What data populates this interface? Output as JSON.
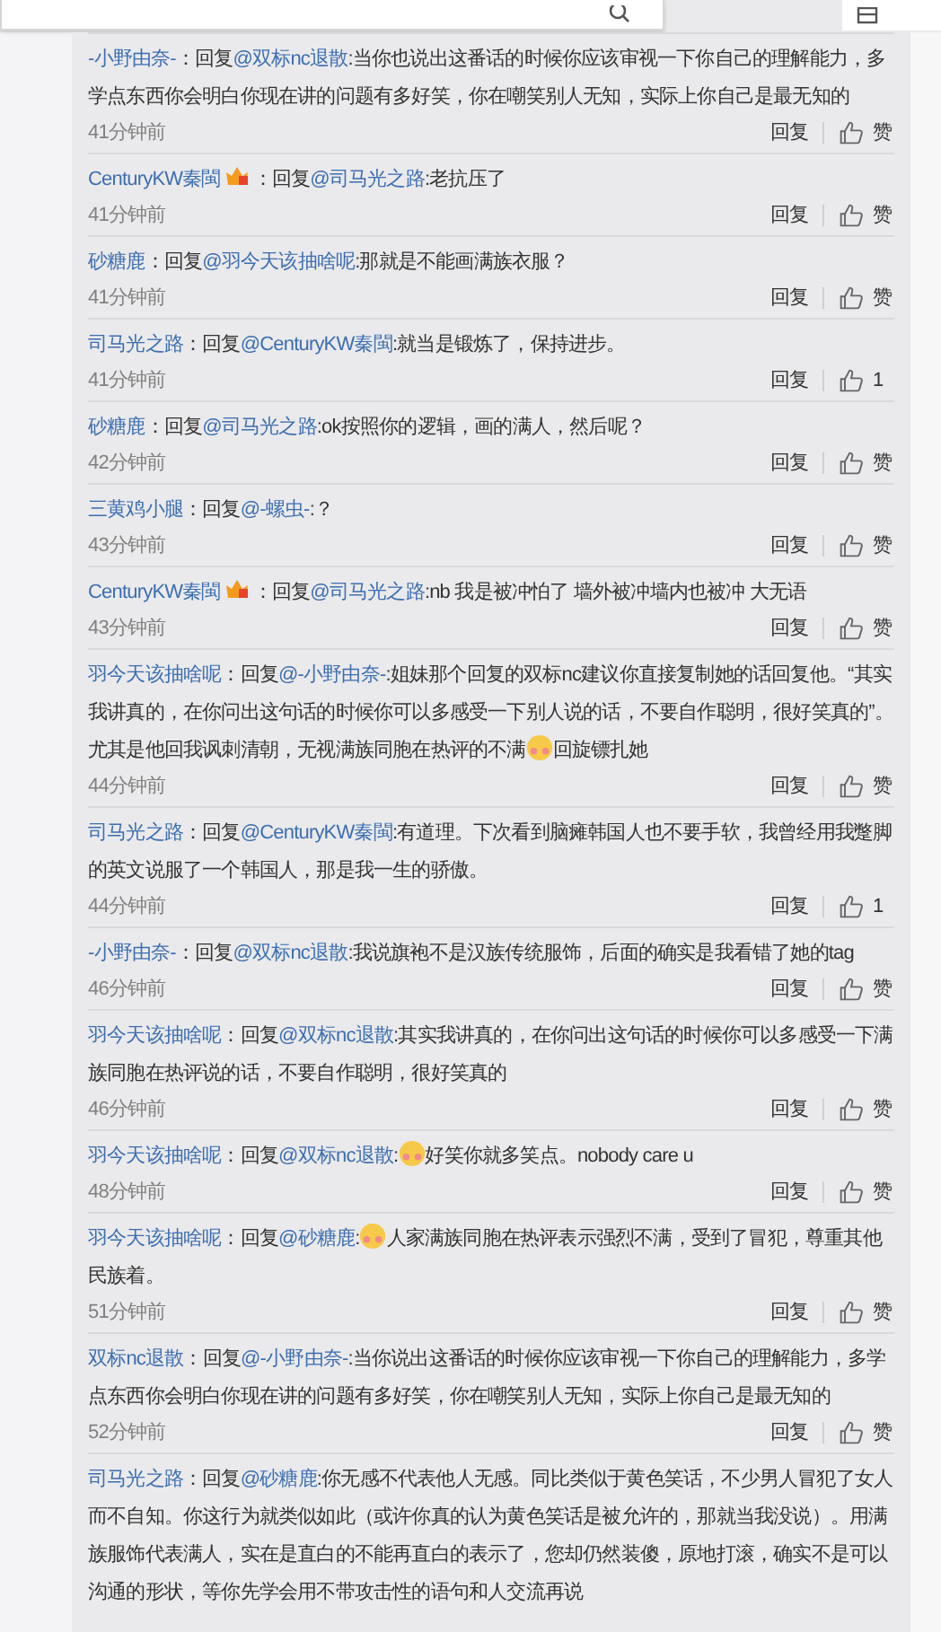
{
  "comments": [
    {
      "user": "-小野由奈-",
      "badge": false,
      "reply": "：回复",
      "target": "@双标nc退散",
      "parts": [
        {
          "kind": "text",
          "text": ":当你也说出这番话的时候你应该审视一下你自己的理解能力，多学点东西你会明白你现在讲的问题有多好笑，你在嘲笑别人无知，实际上你自己是最无知的"
        }
      ],
      "time": "41分钟前",
      "reply_button": "回复",
      "like": "赞"
    },
    {
      "user": "CenturyKW秦閩",
      "badge": true,
      "reply": "：回复",
      "target": "@司马光之路",
      "parts": [
        {
          "kind": "text",
          "text": ":老抗压了"
        }
      ],
      "time": "41分钟前",
      "reply_button": "回复",
      "like": "赞"
    },
    {
      "user": "砂糖鹿",
      "badge": false,
      "reply": "：回复",
      "target": "@羽今天该抽啥呢",
      "parts": [
        {
          "kind": "text",
          "text": ":那就是不能画满族衣服？"
        }
      ],
      "time": "41分钟前",
      "reply_button": "回复",
      "like": "赞"
    },
    {
      "user": "司马光之路",
      "badge": false,
      "reply": "：回复",
      "target": "@CenturyKW秦閩",
      "parts": [
        {
          "kind": "text",
          "text": ":就当是锻炼了，保持进步。"
        }
      ],
      "time": "41分钟前",
      "reply_button": "回复",
      "like": "1"
    },
    {
      "user": "砂糖鹿",
      "badge": false,
      "reply": "：回复",
      "target": "@司马光之路",
      "parts": [
        {
          "kind": "text",
          "text": ":ok按照你的逻辑，画的满人，然后呢？"
        }
      ],
      "time": "42分钟前",
      "reply_button": "回复",
      "like": "赞"
    },
    {
      "user": "三黄鸡小腿",
      "badge": false,
      "reply": "：回复",
      "target": "@-螺虫-",
      "parts": [
        {
          "kind": "text",
          "text": ":？"
        }
      ],
      "time": "43分钟前",
      "reply_button": "回复",
      "like": "赞"
    },
    {
      "user": "CenturyKW秦閩",
      "badge": true,
      "reply": "：回复",
      "target": "@司马光之路",
      "parts": [
        {
          "kind": "text",
          "text": ":nb 我是被冲怕了 墙外被冲墙内也被冲 大无语"
        }
      ],
      "time": "43分钟前",
      "reply_button": "回复",
      "like": "赞"
    },
    {
      "user": "羽今天该抽啥呢",
      "badge": false,
      "reply": "：回复",
      "target": "@-小野由奈-",
      "parts": [
        {
          "kind": "text",
          "text": ":姐妹那个回复的双标nc建议你直接复制她的话回复他。“其实我讲真的，在你问出这句话的时候你可以多感受一下别人说的话，不要自作聪明，很好笑真的”。尤其是他回我讽刺清朝，无视满族同胞在热评的不满"
        },
        {
          "kind": "emoji"
        },
        {
          "kind": "text",
          "text": "回旋镖扎她"
        }
      ],
      "time": "44分钟前",
      "reply_button": "回复",
      "like": "赞"
    },
    {
      "user": "司马光之路",
      "badge": false,
      "reply": "：回复",
      "target": "@CenturyKW秦閩",
      "parts": [
        {
          "kind": "text",
          "text": ":有道理。下次看到脑瘫韩国人也不要手软，我曾经用我蹩脚的英文说服了一个韩国人，那是我一生的骄傲。"
        }
      ],
      "time": "44分钟前",
      "reply_button": "回复",
      "like": "1"
    },
    {
      "user": "-小野由奈-",
      "badge": false,
      "reply": "：回复",
      "target": "@双标nc退散",
      "parts": [
        {
          "kind": "text",
          "text": ":我说旗袍不是汉族传统服饰，后面的确实是我看错了她的tag"
        }
      ],
      "time": "46分钟前",
      "reply_button": "回复",
      "like": "赞"
    },
    {
      "user": "羽今天该抽啥呢",
      "badge": false,
      "reply": "：回复",
      "target": "@双标nc退散",
      "parts": [
        {
          "kind": "text",
          "text": ":其实我讲真的，在你问出这句话的时候你可以多感受一下满族同胞在热评说的话，不要自作聪明，很好笑真的"
        }
      ],
      "time": "46分钟前",
      "reply_button": "回复",
      "like": "赞"
    },
    {
      "user": "羽今天该抽啥呢",
      "badge": false,
      "reply": "：回复",
      "target": "@双标nc退散",
      "parts": [
        {
          "kind": "text",
          "text": ":"
        },
        {
          "kind": "emoji"
        },
        {
          "kind": "text",
          "text": "好笑你就多笑点。nobody care u"
        }
      ],
      "time": "48分钟前",
      "reply_button": "回复",
      "like": "赞"
    },
    {
      "user": "羽今天该抽啥呢",
      "badge": false,
      "reply": "：回复",
      "target": "@砂糖鹿",
      "parts": [
        {
          "kind": "text",
          "text": ":"
        },
        {
          "kind": "emoji"
        },
        {
          "kind": "text",
          "text": "人家满族同胞在热评表示强烈不满，受到了冒犯，尊重其他民族着。"
        }
      ],
      "time": "51分钟前",
      "reply_button": "回复",
      "like": "赞"
    },
    {
      "user": "双标nc退散",
      "badge": false,
      "reply": "：回复",
      "target": "@-小野由奈-",
      "parts": [
        {
          "kind": "text",
          "text": ":当你说出这番话的时候你应该审视一下你自己的理解能力，多学点东西你会明白你现在讲的问题有多好笑，你在嘲笑别人无知，实际上你自己是最无知的"
        }
      ],
      "time": "52分钟前",
      "reply_button": "回复",
      "like": "赞"
    },
    {
      "user": "司马光之路",
      "badge": false,
      "reply": "：回复",
      "target": "@砂糖鹿",
      "parts": [
        {
          "kind": "text",
          "text": ":你无感不代表他人无感。同比类似于黄色笑话，不少男人冒犯了女人而不自知。你这行为就类似如此（或许你真的认为黄色笑话是被允许的，那就当我没说）。用满族服饰代表满人，实在是直白的不能再直白的表示了，您却仍然装傻，原地打滚，确实不是可以沟通的形状，等你先学会用不带攻击性的语句和人交流再说"
        }
      ]
    }
  ]
}
